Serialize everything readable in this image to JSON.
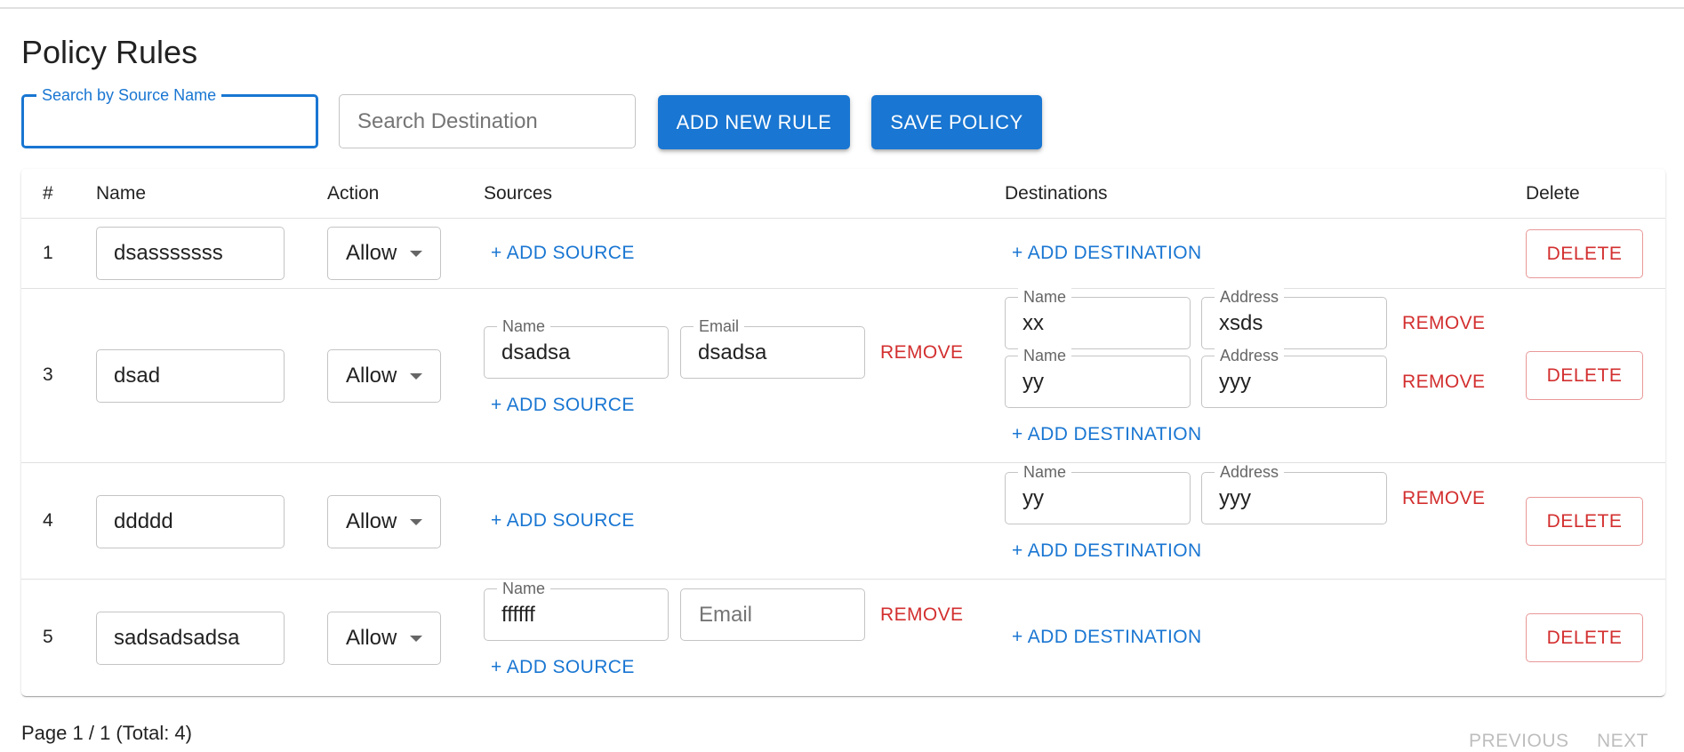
{
  "page": {
    "title": "Policy Rules"
  },
  "search": {
    "source_label": "Search by Source Name",
    "source_value": "",
    "destination_placeholder": "Search Destination"
  },
  "toolbar": {
    "add_rule_label": "ADD NEW RULE",
    "save_policy_label": "SAVE POLICY"
  },
  "table": {
    "headers": {
      "num": "#",
      "name": "Name",
      "action": "Action",
      "sources": "Sources",
      "destinations": "Destinations",
      "delete": "Delete"
    },
    "rows": [
      {
        "num": "1",
        "name": "dsasssssss",
        "action": "Allow",
        "sources": [],
        "destinations": []
      },
      {
        "num": "3",
        "name": "dsad",
        "action": "Allow",
        "sources": [
          {
            "name": "dsadsa",
            "email": "dsadsa"
          }
        ],
        "destinations": [
          {
            "name": "xx",
            "address": "xsds"
          },
          {
            "name": "yy",
            "address": "yyy"
          }
        ]
      },
      {
        "num": "4",
        "name": "ddddd",
        "action": "Allow",
        "sources": [],
        "destinations": [
          {
            "name": "yy",
            "address": "yyy"
          }
        ]
      },
      {
        "num": "5",
        "name": "sadsadsadsa",
        "action": "Allow",
        "sources": [
          {
            "name": "ffffff",
            "email": ""
          }
        ],
        "destinations": []
      }
    ]
  },
  "labels": {
    "field_name": "Name",
    "field_email": "Email",
    "field_address": "Address",
    "email_placeholder": "Email",
    "add_source": "+ ADD SOURCE",
    "add_destination": "+ ADD DESTINATION",
    "remove": "REMOVE",
    "delete": "DELETE"
  },
  "pagination": {
    "status": "Page 1 / 1 (Total: 4)",
    "previous": "PREVIOUS",
    "next": "NEXT"
  },
  "colors": {
    "primary": "#1976d2",
    "error": "#d32f2f",
    "border": "#c4c4c4"
  }
}
